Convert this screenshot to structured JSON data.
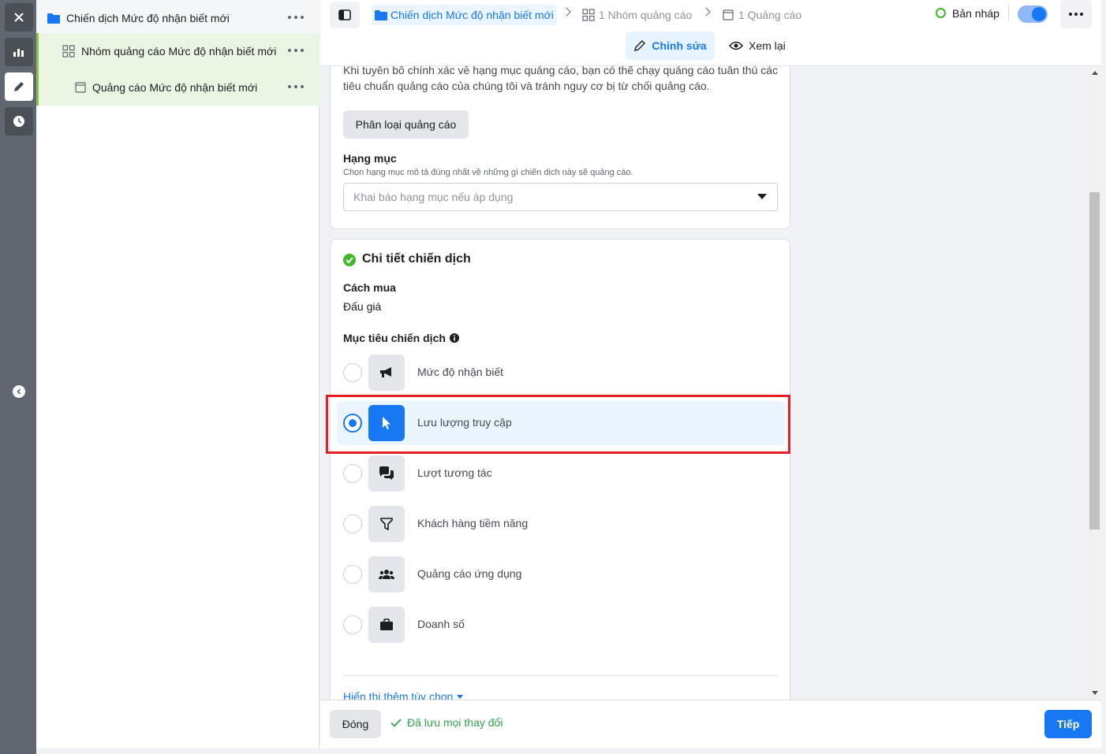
{
  "tree": {
    "campaign": "Chiến dịch Mức độ nhận biết mới",
    "adset": "Nhóm quảng cáo Mức độ nhận biết mới",
    "ad": "Quảng cáo Mức độ nhận biết mới"
  },
  "header": {
    "breadcrumb_campaign": "Chiến dịch Mức độ nhận biết mới",
    "breadcrumb_adset": "1 Nhóm quảng cáo",
    "breadcrumb_ad": "1 Quảng cáo",
    "status": "Bản nháp",
    "edit_label": "Chỉnh sửa",
    "review_label": "Xem lại"
  },
  "special_category": {
    "description_line1": "Khi tuyên bố chính xác về hạng mục quảng cáo, bạn có thể chạy quảng cáo tuân thủ các",
    "description_line2": "tiêu chuẩn quảng cáo của chúng tôi và tránh nguy cơ bị từ chối quảng cáo.",
    "button": "Phân loại quảng cáo",
    "category_label": "Hạng mục",
    "category_help": "Chọn hạng mục mô tả đúng nhất về những gì chiến dịch này sẽ quảng cáo.",
    "category_placeholder": "Khai báo hạng mục nếu áp dụng"
  },
  "campaign_details": {
    "title": "Chi tiết chiến dịch",
    "buying_type_label": "Cách mua",
    "buying_type_value": "Đấu giá",
    "objective_label": "Mục tiêu chiến dịch",
    "objectives": [
      {
        "label": "Mức độ nhận biết",
        "icon": "megaphone-icon",
        "selected": false
      },
      {
        "label": "Lưu lượng truy cập",
        "icon": "cursor-icon",
        "selected": true
      },
      {
        "label": "Lượt tương tác",
        "icon": "chat-bubbles-icon",
        "selected": false
      },
      {
        "label": "Khách hàng tiềm năng",
        "icon": "funnel-icon",
        "selected": false
      },
      {
        "label": "Quảng cáo ứng dụng",
        "icon": "people-icon",
        "selected": false
      },
      {
        "label": "Doanh số",
        "icon": "briefcase-icon",
        "selected": false
      }
    ],
    "show_more": "Hiển thị thêm tùy chọn"
  },
  "footer": {
    "close": "Đóng",
    "saved": "Đã lưu mọi thay đổi",
    "next": "Tiếp"
  },
  "colors": {
    "accent": "#1877f2",
    "highlight_border": "#e41e26",
    "selected_bg": "#ebf5ff",
    "success": "#42b72a",
    "tree_bg_selected": "#eaf5e3"
  }
}
